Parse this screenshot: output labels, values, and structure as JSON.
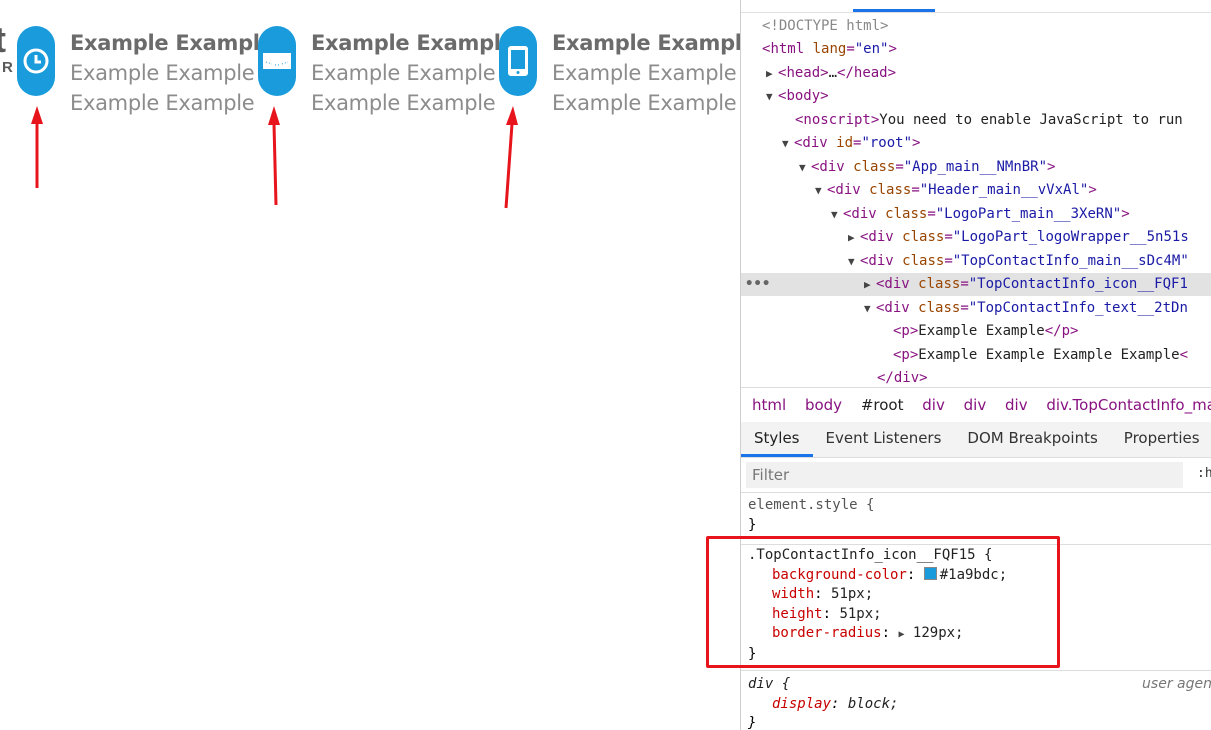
{
  "page": {
    "logo_fragment": {
      "top": "t",
      "bottom": "R"
    },
    "contacts": [
      {
        "icon": "clock-icon",
        "bold": "Example Example",
        "line2": "Example Example",
        "line3": "Example Example"
      },
      {
        "icon": "envelope-icon",
        "bold": "Example Example",
        "line2": "Example Example",
        "line3": "Example Example"
      },
      {
        "icon": "phone-icon",
        "bold": "Example Example",
        "line2": "Example Example",
        "line3": "Example Example"
      }
    ],
    "accent_color": "#1a9bdc",
    "annotation_color": "#e8141c"
  },
  "devtools": {
    "dom": {
      "doctype": "<!DOCTYPE html>",
      "html_tag": "html",
      "html_attr": "lang",
      "html_val": "\"en\"",
      "head": "head",
      "body": "body",
      "noscript_text": "You need to enable JavaScript to run",
      "root_id": "\"root\"",
      "app_class": "\"App_main__NMnBR\"",
      "header_class": "\"Header_main__vVxAl\"",
      "logopart_class": "\"LogoPart_main__3XeRN\"",
      "logowrapper_class": "\"LogoPart_logoWrapper__5n51s",
      "topcontact_class": "\"TopContactInfo_main__sDc4M\"",
      "icon_class": "\"TopContactInfo_icon__FQF1",
      "text_class": "\"TopContactInfo_text__2tDn",
      "p1": "Example Example",
      "p2": "Example Example Example Example"
    },
    "breadcrumbs": [
      "html",
      "body",
      "#root",
      "div",
      "div",
      "div",
      "div.TopContactInfo_mai"
    ],
    "tabs": [
      "Styles",
      "Event Listeners",
      "DOM Breakpoints",
      "Properties"
    ],
    "active_tab": "Styles",
    "filter_placeholder": "Filter",
    "filter_hov": ":h",
    "rules": {
      "element_style": "element.style {",
      "close": "}",
      "icon_selector": ".TopContactInfo_icon__FQF15 {",
      "decls": [
        {
          "prop": "background-color",
          "value": "#1a9bdc;",
          "swatch": "#1a9bdc"
        },
        {
          "prop": "width",
          "value": "51px;"
        },
        {
          "prop": "height",
          "value": "51px;"
        },
        {
          "prop": "border-radius",
          "value": "129px;"
        }
      ],
      "div_selector": "div {",
      "div_prop": "display",
      "div_value": "block;",
      "user_agent": "user agen"
    }
  }
}
